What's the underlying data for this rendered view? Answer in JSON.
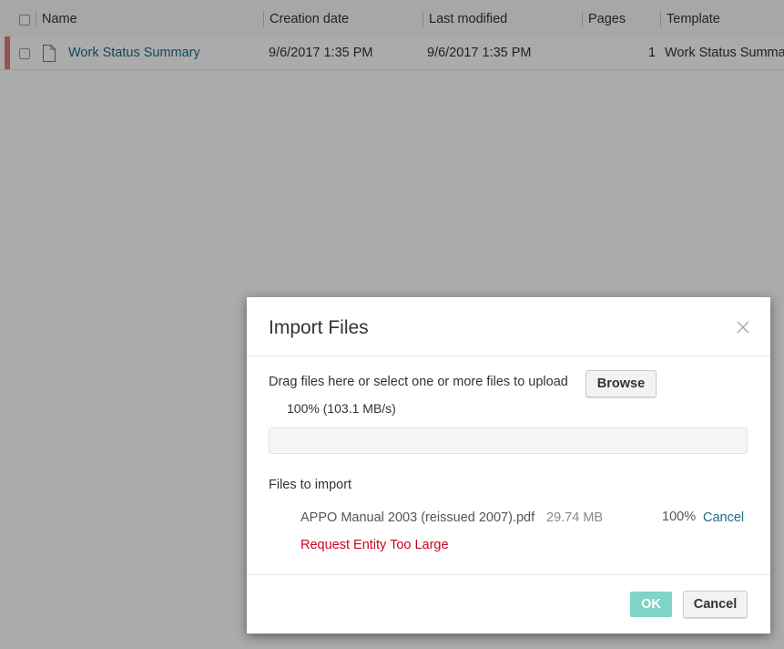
{
  "table": {
    "columns": [
      "Name",
      "Creation date",
      "Last modified",
      "Pages",
      "Template"
    ],
    "rows": [
      {
        "name": "Work Status Summary",
        "creation_date": "9/6/2017 1:35 PM",
        "last_modified": "9/6/2017 1:35 PM",
        "pages": "1",
        "template": "Work Status Summa"
      }
    ]
  },
  "dialog": {
    "title": "Import Files",
    "drag_text": "Drag files here or select one or more files to upload",
    "browse_label": "Browse",
    "progress_text": "100% (103.1 MB/s)",
    "progress_fraction": 1.0,
    "files_label": "Files to import",
    "files": [
      {
        "name": "APPO Manual 2003 (reissued 2007).pdf",
        "size": "29.74 MB",
        "percent": "100%",
        "cancel_label": "Cancel",
        "error": "Request Entity Too Large"
      }
    ],
    "ok_label": "OK",
    "cancel_label": "Cancel"
  },
  "colors": {
    "accent_link": "#1a6f87",
    "ok_button": "#7fd4c7",
    "error": "#d0021b",
    "row_marker": "#e07b78"
  }
}
